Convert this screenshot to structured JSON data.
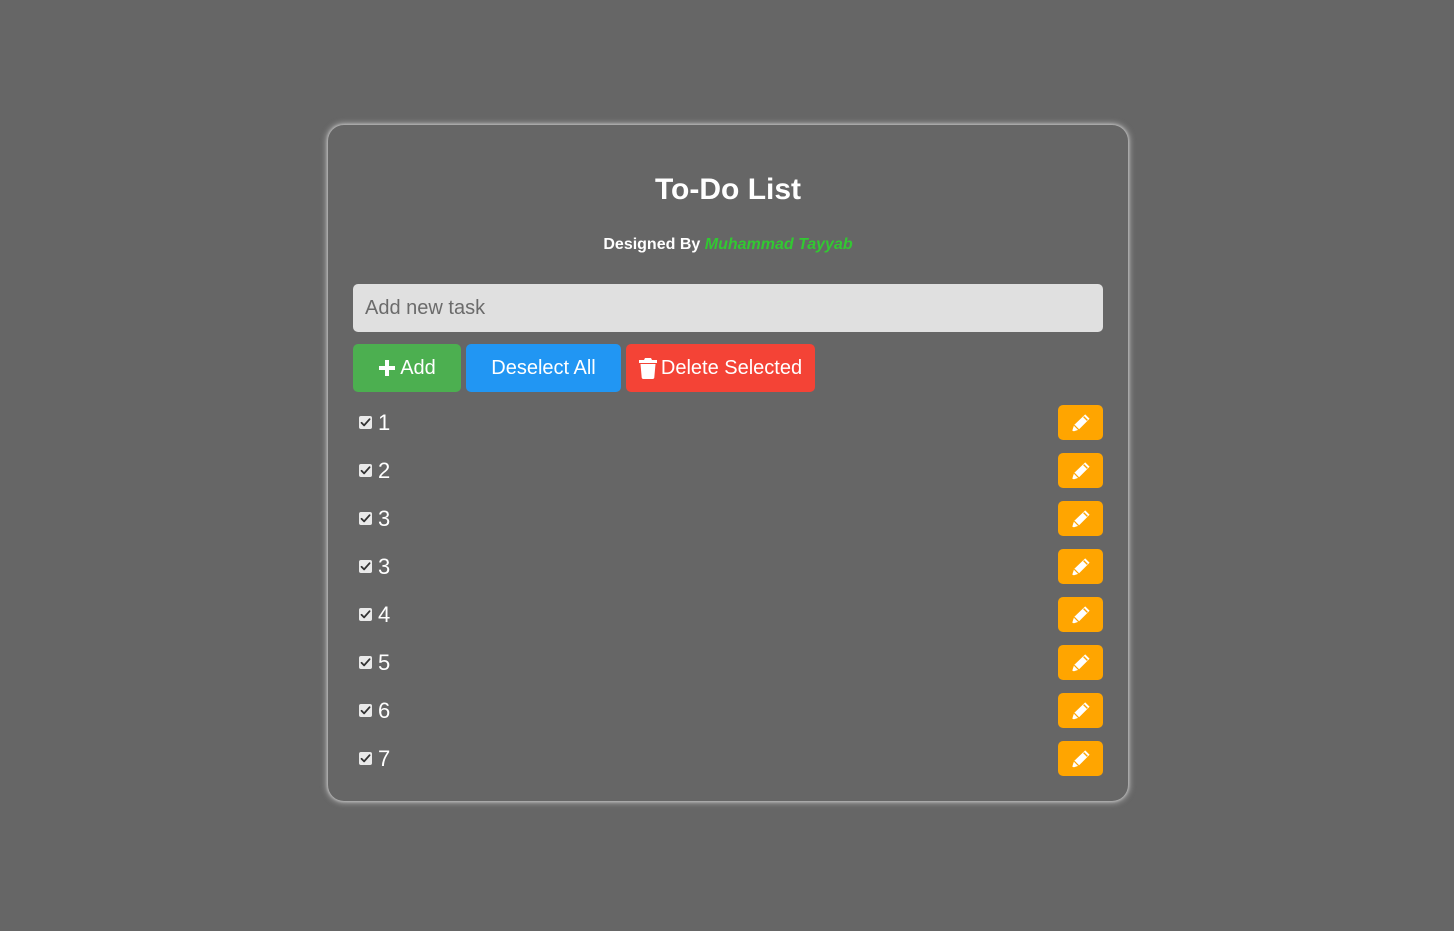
{
  "app": {
    "title": "To-Do List",
    "subtitle_prefix": "Designed By",
    "author": "Muhammad Tayyab"
  },
  "input": {
    "placeholder": "Add new task",
    "value": ""
  },
  "buttons": {
    "add_label": "Add",
    "deselect_label": "Deselect All",
    "delete_label": "Delete Selected"
  },
  "tasks": [
    {
      "text": "1",
      "checked": true
    },
    {
      "text": "2",
      "checked": true
    },
    {
      "text": "3",
      "checked": true
    },
    {
      "text": "3",
      "checked": true
    },
    {
      "text": "4",
      "checked": true
    },
    {
      "text": "5",
      "checked": true
    },
    {
      "text": "6",
      "checked": true
    },
    {
      "text": "7",
      "checked": true
    }
  ],
  "icons": {
    "add": "plus-icon",
    "delete": "trash-icon",
    "edit": "pencil-icon",
    "check": "checkmark-icon"
  },
  "colors": {
    "background": "#666666",
    "add": "#4caf50",
    "deselect": "#2196f3",
    "delete": "#f44336",
    "edit": "#ffa500",
    "author": "#32c832"
  }
}
